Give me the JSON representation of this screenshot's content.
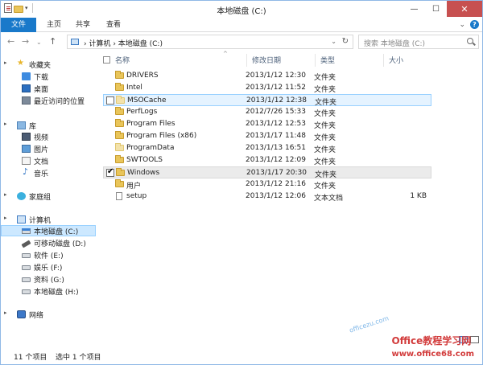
{
  "window": {
    "title": "本地磁盘 (C:)",
    "controls": {
      "minimize": "—",
      "maximize": "☐",
      "close": "✕"
    }
  },
  "ribbon": {
    "tabs": [
      "文件",
      "主页",
      "共享",
      "查看"
    ],
    "collapse_glyph": "⌄"
  },
  "address": {
    "path": "› 计算机 › 本地磁盘 (C:)",
    "dropdown_glyph": "⌄",
    "refresh_glyph": "↻",
    "nav_glyphs": {
      "back": "←",
      "forward": "→",
      "dropdown": "⌄",
      "up": "↑"
    }
  },
  "search": {
    "placeholder": "搜索 本地磁盘 (C:)"
  },
  "nav": {
    "favorites": {
      "label": "收藏夹",
      "items": [
        "下载",
        "桌面",
        "最近访问的位置"
      ]
    },
    "libraries": {
      "label": "库",
      "items": [
        "视频",
        "图片",
        "文档",
        "音乐"
      ]
    },
    "homegroup": {
      "label": "家庭组"
    },
    "computer": {
      "label": "计算机",
      "items": [
        "本地磁盘 (C:)",
        "可移动磁盘 (D:)",
        "软件 (E:)",
        "娱乐 (F:)",
        "资料 (G:)",
        "本地磁盘 (H:)"
      ]
    },
    "network": {
      "label": "网络"
    }
  },
  "columns": {
    "name": "名称",
    "date": "修改日期",
    "type": "类型",
    "size": "大小",
    "sort_glyph": "^"
  },
  "rows": [
    {
      "name": "DRIVERS",
      "date": "2013/1/12 12:30",
      "type": "文件夹",
      "size": "",
      "kind": "folder"
    },
    {
      "name": "Intel",
      "date": "2013/1/12 11:52",
      "type": "文件夹",
      "size": "",
      "kind": "folder"
    },
    {
      "name": "MSOCache",
      "date": "2013/1/12 12:38",
      "type": "文件夹",
      "size": "",
      "kind": "folder-hidden",
      "state": "hover"
    },
    {
      "name": "PerfLogs",
      "date": "2012/7/26 15:33",
      "type": "文件夹",
      "size": "",
      "kind": "folder"
    },
    {
      "name": "Program Files",
      "date": "2013/1/12 12:53",
      "type": "文件夹",
      "size": "",
      "kind": "folder"
    },
    {
      "name": "Program Files (x86)",
      "date": "2013/1/17 11:48",
      "type": "文件夹",
      "size": "",
      "kind": "folder"
    },
    {
      "name": "ProgramData",
      "date": "2013/1/13 16:51",
      "type": "文件夹",
      "size": "",
      "kind": "folder-hidden"
    },
    {
      "name": "SWTOOLS",
      "date": "2013/1/12 12:09",
      "type": "文件夹",
      "size": "",
      "kind": "folder"
    },
    {
      "name": "Windows",
      "date": "2013/1/17 20:30",
      "type": "文件夹",
      "size": "",
      "kind": "folder",
      "state": "checked"
    },
    {
      "name": "用户",
      "date": "2013/1/12 21:16",
      "type": "文件夹",
      "size": "",
      "kind": "folder"
    },
    {
      "name": "setup",
      "date": "2013/1/12 12:06",
      "type": "文本文档",
      "size": "1 KB",
      "kind": "file"
    }
  ],
  "status": {
    "count": "11 个项目",
    "selected": "选中 1 个项目"
  },
  "watermark": {
    "text": "Office教程学习网",
    "url": "www.office68.com",
    "small": "officezu.com"
  }
}
